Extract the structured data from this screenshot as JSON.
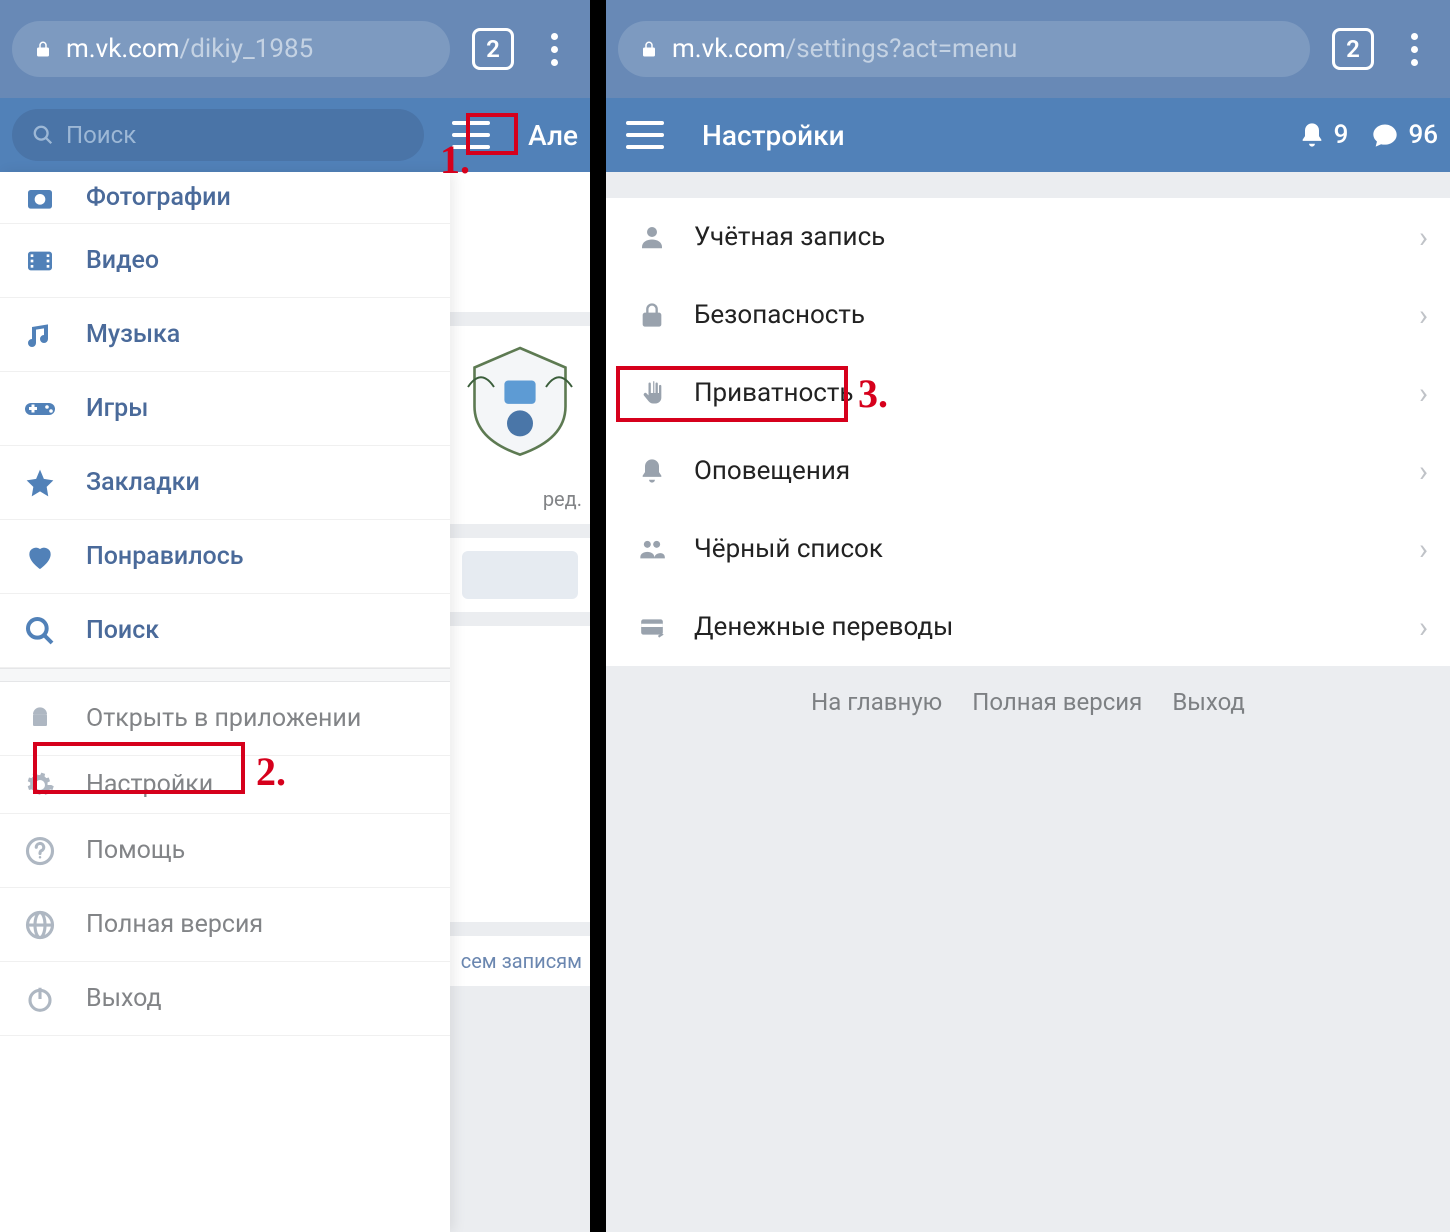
{
  "browser": {
    "left_url_domain": "m.vk.com",
    "left_url_path": "/dikiy_1985",
    "right_url_domain": "m.vk.com",
    "right_url_path": "/settings?act=menu",
    "tab_count": "2"
  },
  "left": {
    "search_placeholder": "Поиск",
    "profile_name_partial": "Але",
    "edit_text": "ред.",
    "all_posts_text": "сем записям",
    "menu": [
      {
        "label": "Фотографии",
        "icon": "camera"
      },
      {
        "label": "Видео",
        "icon": "video"
      },
      {
        "label": "Музыка",
        "icon": "music"
      },
      {
        "label": "Игры",
        "icon": "gamepad"
      },
      {
        "label": "Закладки",
        "icon": "star"
      },
      {
        "label": "Понравилось",
        "icon": "heart"
      },
      {
        "label": "Поиск",
        "icon": "search"
      }
    ],
    "footer_menu": [
      {
        "label": "Открыть в приложении",
        "icon": "android"
      },
      {
        "label": "Настройки",
        "icon": "gear"
      },
      {
        "label": "Помощь",
        "icon": "help"
      },
      {
        "label": "Полная версия",
        "icon": "globe"
      },
      {
        "label": "Выход",
        "icon": "power"
      }
    ]
  },
  "right": {
    "header_title": "Настройки",
    "notif_count": "9",
    "msg_count": "96",
    "settings": [
      {
        "label": "Учётная запись",
        "icon": "user"
      },
      {
        "label": "Безопасность",
        "icon": "lock"
      },
      {
        "label": "Приватность",
        "icon": "hand"
      },
      {
        "label": "Оповещения",
        "icon": "bell"
      },
      {
        "label": "Чёрный список",
        "icon": "people"
      },
      {
        "label": "Денежные переводы",
        "icon": "card"
      }
    ],
    "footer_links": [
      "На главную",
      "Полная версия",
      "Выход"
    ]
  },
  "annotations": {
    "step1": "1.",
    "step2": "2.",
    "step3": "3."
  }
}
